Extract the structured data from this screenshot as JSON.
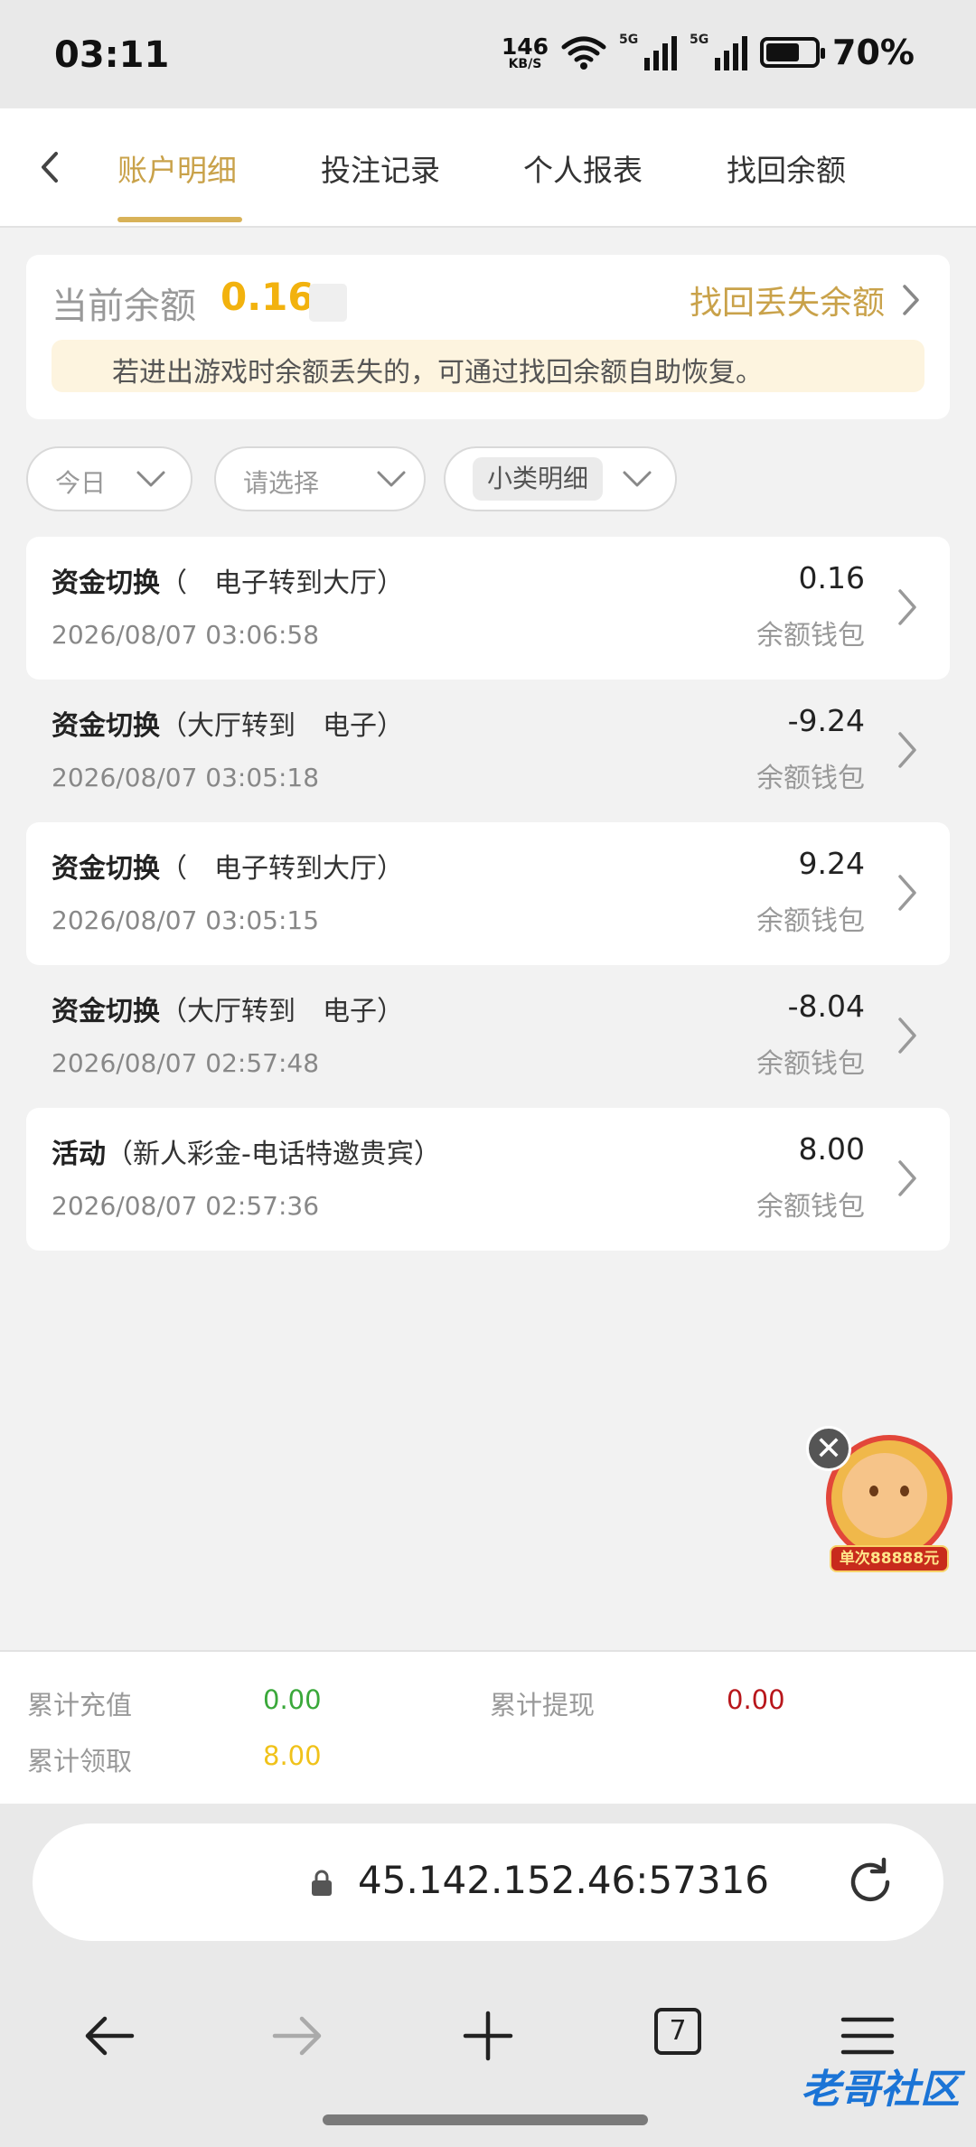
{
  "status_bar": {
    "time": "03:11",
    "speed_value": "146",
    "speed_unit": "KB/S",
    "network_1": "5G",
    "network_2": "5G",
    "battery_level": 0.7,
    "battery_pct": "70%"
  },
  "tabs": [
    {
      "label": "账户明细",
      "active": true
    },
    {
      "label": "投注记录",
      "active": false
    },
    {
      "label": "个人报表",
      "active": false
    },
    {
      "label": "找回余额",
      "active": false
    }
  ],
  "balance": {
    "label": "当前余额",
    "value": "0.16",
    "recover_link": "找回丢失余额",
    "tip": "若进出游戏时余额丢失的，可通过找回余额自助恢复。"
  },
  "filters": {
    "date": "今日",
    "category_placeholder": "请选择",
    "subcategory": "小类明细"
  },
  "records": [
    {
      "type": "资金切换",
      "detail": "（　电子转到大厅）",
      "time": "2026/08/07 03:06:58",
      "amount": "0.16",
      "wallet": "余额钱包"
    },
    {
      "type": "资金切换",
      "detail": "（大厅转到　电子）",
      "time": "2026/08/07 03:05:18",
      "amount": "-9.24",
      "wallet": "余额钱包"
    },
    {
      "type": "资金切换",
      "detail": "（　电子转到大厅）",
      "time": "2026/08/07 03:05:15",
      "amount": "9.24",
      "wallet": "余额钱包"
    },
    {
      "type": "资金切换",
      "detail": "（大厅转到　电子）",
      "time": "2026/08/07 02:57:48",
      "amount": "-8.04",
      "wallet": "余额钱包"
    },
    {
      "type": "活动",
      "detail": "（新人彩金-电话特邀贵宾）",
      "time": "2026/08/07 02:57:36",
      "amount": "8.00",
      "wallet": "余额钱包"
    }
  ],
  "float_ad": {
    "banner": "单次88888元"
  },
  "summary": {
    "deposit_label": "累计充值",
    "deposit_value": "0.00",
    "withdraw_label": "累计提现",
    "withdraw_value": "0.00",
    "received_label": "累计领取",
    "received_value": "8.00"
  },
  "browser": {
    "url": "45.142.152.46:57316",
    "tab_count": "7",
    "watermark": "老哥社区"
  },
  "colors": {
    "accent": "#c9a24a",
    "balance": "#f2b20e",
    "deposit": "#3aa83a",
    "withdraw": "#b8161b",
    "received": "#f0c21a"
  }
}
